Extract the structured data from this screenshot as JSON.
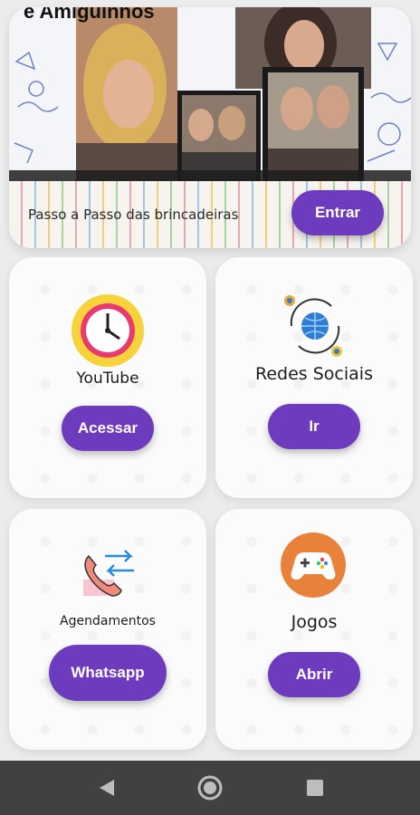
{
  "hero": {
    "title_fragment": "e Amiguinhos",
    "label": "Passo a Passo das brincadeiras",
    "button": "Entrar"
  },
  "cards": [
    {
      "label": "YouTube",
      "button": "Acessar",
      "icon": "clock-icon"
    },
    {
      "label": "Redes Sociais",
      "button": "Ir",
      "icon": "globe-network-icon"
    },
    {
      "label": "Agendamentos",
      "button": "Whatsapp",
      "icon": "phone-transfer-icon"
    },
    {
      "label": "Jogos",
      "button": "Abrir",
      "icon": "gamepad-icon"
    }
  ],
  "colors": {
    "accent": "#6d3bbd",
    "navbar": "#3f4143"
  },
  "navbar": {
    "icons": [
      "back-icon",
      "home-icon",
      "recents-icon"
    ]
  }
}
